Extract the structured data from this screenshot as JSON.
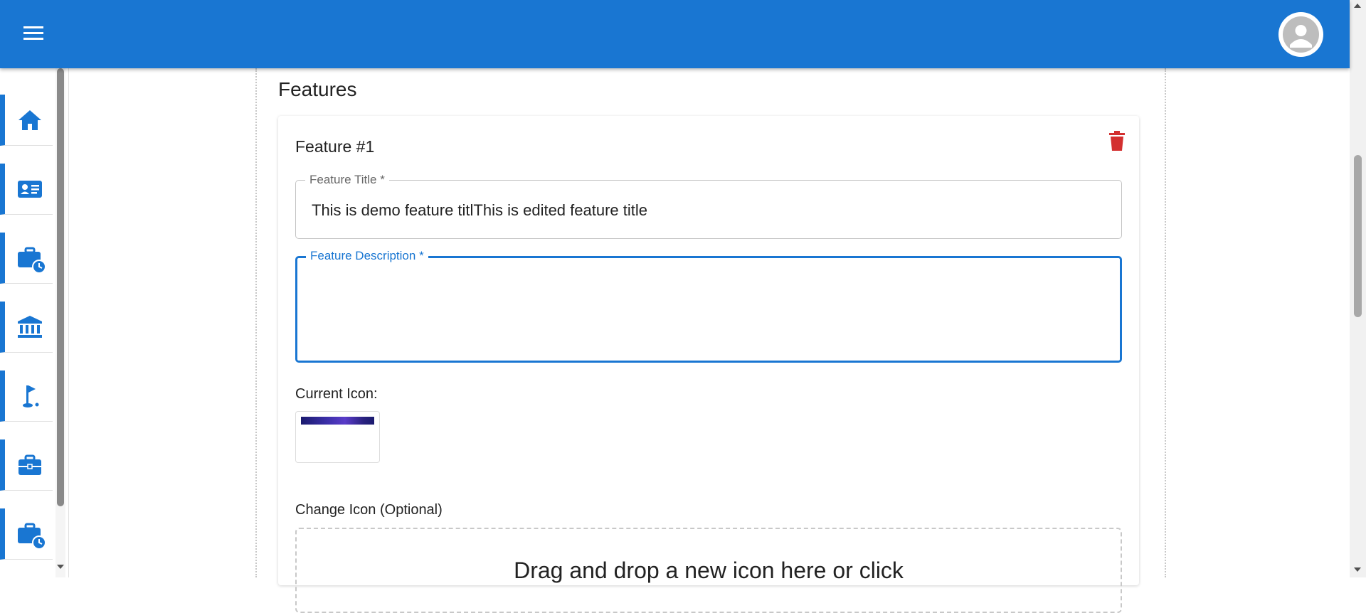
{
  "header": {
    "menu_icon": "hamburger-menu-icon",
    "profile_icon": "account-circle-icon"
  },
  "sidebar": {
    "items": [
      {
        "icon": "home-icon"
      },
      {
        "icon": "contact-card-icon"
      },
      {
        "icon": "work-history-icon"
      },
      {
        "icon": "bank-icon"
      },
      {
        "icon": "golf-flag-icon"
      },
      {
        "icon": "briefcase-icon"
      },
      {
        "icon": "work-history-icon"
      }
    ]
  },
  "features": {
    "section_title": "Features",
    "feature": {
      "title": "Feature #1",
      "delete_icon": "trash-icon",
      "title_field": {
        "label": "Feature Title *",
        "value": "This is demo feature titlThis is edited feature title"
      },
      "description_field": {
        "label": "Feature Description *",
        "value": ""
      },
      "current_icon_label": "Current Icon:",
      "change_icon_label": "Change Icon (Optional)",
      "dropzone_text": "Drag and drop a new icon here or click"
    }
  },
  "colors": {
    "primary": "#1976d2",
    "danger": "#d32f2f"
  }
}
